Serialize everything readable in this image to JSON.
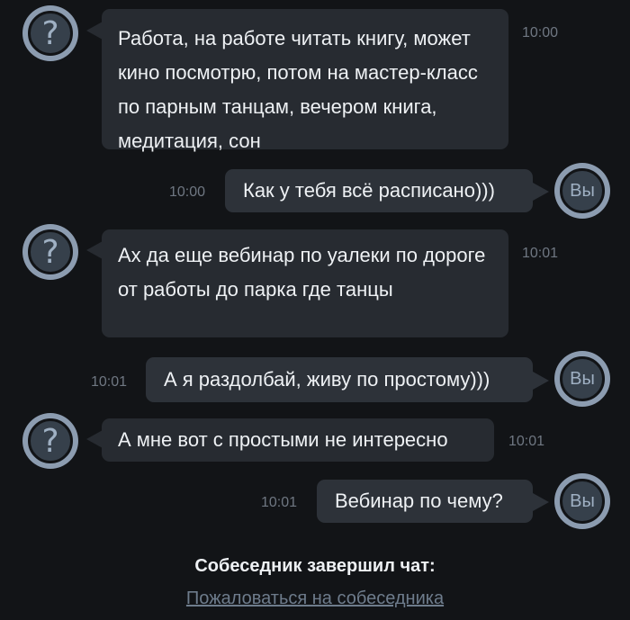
{
  "stranger_avatar_glyph": "?",
  "my_avatar_label": "Вы",
  "messages": [
    {
      "from": "stranger",
      "text": "Работа, на работе читать книгу, может кино посмотрю, потом на мастер-класс по парным танцам, вечером книга, медитация, сон",
      "time": "10:00"
    },
    {
      "from": "me",
      "text": "Как у тебя всё расписано)))",
      "time": "10:00"
    },
    {
      "from": "stranger",
      "text": "Ах да еще вебинар по уалеки по дороге от работы до парка где танцы",
      "time": "10:01"
    },
    {
      "from": "me",
      "text": "А я раздолбай, живу по простому)))",
      "time": "10:01"
    },
    {
      "from": "stranger",
      "text": "А мне вот с простыми не интересно",
      "time": "10:01"
    },
    {
      "from": "me",
      "text": "Вебинар по чему?",
      "time": "10:01"
    }
  ],
  "footer": {
    "ended_text": "Собеседник завершил чат:",
    "report_link": "Пожаловаться на собеседника"
  },
  "colors": {
    "background": "#121417",
    "bubble": "#272b31",
    "bubble_mine": "#2d3239",
    "avatar_ring": "#8c9cb0",
    "time": "#6f7782",
    "link": "#6e7c8c"
  }
}
